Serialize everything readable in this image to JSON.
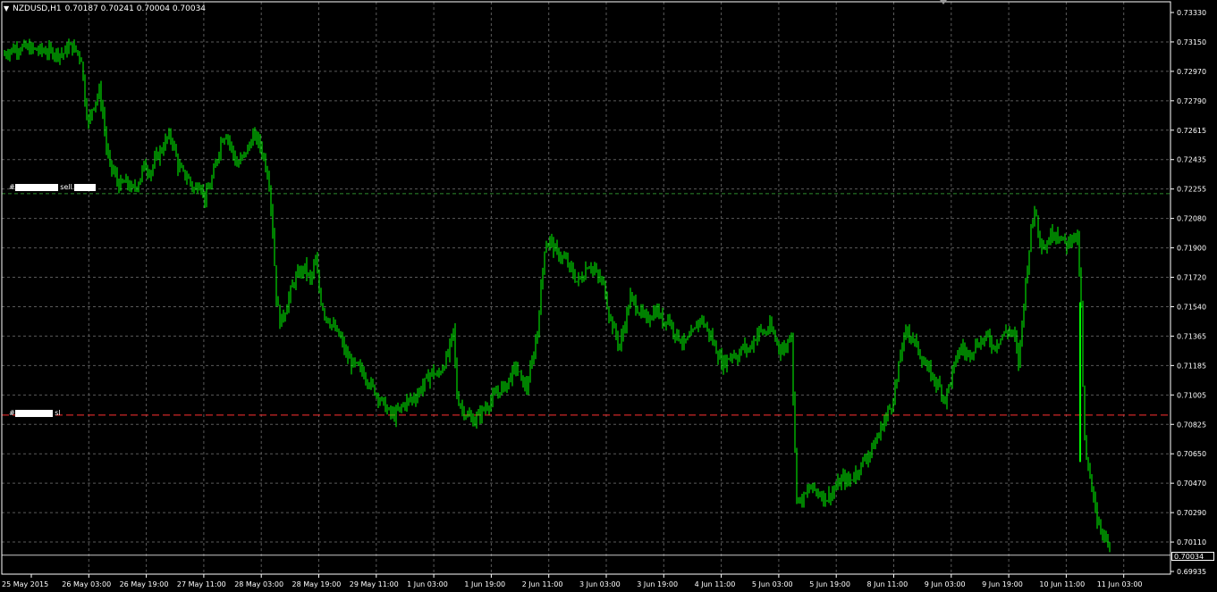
{
  "chart_window": {
    "symbol_header": "NZDUSD,H1",
    "ohlc_header": "0.70187 0.70241 0.70004 0.70034",
    "menu_icon": "triangle-down-icon",
    "colors": {
      "background": "#000000",
      "candle": "#00ff00",
      "grid": "#5a5a5a",
      "axis": "#ffffff",
      "entry_line": "#2e8b2e",
      "sl_line": "#ff3030"
    },
    "orders": {
      "sell_label_prefix": "#",
      "sell_label_mid": "sell",
      "sell_price": 0.7223,
      "sl_label_prefix": "#",
      "sl_label_mid": "sl",
      "sl_price": 0.70885
    },
    "current_price_label": "0.70034"
  },
  "chart_data": {
    "type": "candlestick",
    "symbol": "NZDUSD",
    "timeframe": "H1",
    "y_ticks": [
      "0.73330",
      "0.73150",
      "0.72970",
      "0.72790",
      "0.72615",
      "0.72435",
      "0.72255",
      "0.72080",
      "0.71900",
      "0.71720",
      "0.71540",
      "0.71365",
      "0.71185",
      "0.71005",
      "0.70825",
      "0.70650",
      "0.70470",
      "0.70290",
      "0.70110",
      "0.69935"
    ],
    "ylim": [
      0.69935,
      0.7333
    ],
    "x_ticks": [
      "25 May 2015",
      "26 May 03:00",
      "26 May 19:00",
      "27 May 11:00",
      "28 May 03:00",
      "28 May 19:00",
      "29 May 11:00",
      "1 Jun 03:00",
      "1 Jun 19:00",
      "2 Jun 11:00",
      "3 Jun 03:00",
      "3 Jun 19:00",
      "4 Jun 11:00",
      "5 Jun 03:00",
      "5 Jun 19:00",
      "8 Jun 11:00",
      "9 Jun 03:00",
      "9 Jun 19:00",
      "10 Jun 11:00",
      "11 Jun 03:00"
    ],
    "current_price": 0.70034,
    "grid": true,
    "close_path": [
      [
        0,
        0.7307
      ],
      [
        8,
        0.731
      ],
      [
        20,
        0.7312
      ],
      [
        30,
        0.7311
      ],
      [
        40,
        0.731
      ],
      [
        55,
        0.7309
      ],
      [
        68,
        0.7308
      ],
      [
        75,
        0.7313
      ],
      [
        82,
        0.731
      ],
      [
        88,
        0.7305
      ],
      [
        92,
        0.728
      ],
      [
        96,
        0.7265
      ],
      [
        100,
        0.7275
      ],
      [
        104,
        0.728
      ],
      [
        108,
        0.7285
      ],
      [
        113,
        0.7268
      ],
      [
        116,
        0.725
      ],
      [
        120,
        0.724
      ],
      [
        125,
        0.7235
      ],
      [
        130,
        0.7228
      ],
      [
        138,
        0.723
      ],
      [
        145,
        0.7225
      ],
      [
        152,
        0.723
      ],
      [
        158,
        0.724
      ],
      [
        165,
        0.7236
      ],
      [
        172,
        0.7245
      ],
      [
        178,
        0.725
      ],
      [
        185,
        0.7258
      ],
      [
        190,
        0.7255
      ],
      [
        196,
        0.724
      ],
      [
        202,
        0.7235
      ],
      [
        208,
        0.7232
      ],
      [
        214,
        0.7225
      ],
      [
        220,
        0.723
      ],
      [
        226,
        0.722
      ],
      [
        232,
        0.7228
      ],
      [
        238,
        0.724
      ],
      [
        244,
        0.7255
      ],
      [
        250,
        0.726
      ],
      [
        256,
        0.725
      ],
      [
        262,
        0.724
      ],
      [
        268,
        0.7245
      ],
      [
        274,
        0.725
      ],
      [
        280,
        0.7258
      ],
      [
        286,
        0.7255
      ],
      [
        292,
        0.7245
      ],
      [
        298,
        0.723
      ],
      [
        302,
        0.72
      ],
      [
        306,
        0.716
      ],
      [
        310,
        0.7145
      ],
      [
        315,
        0.715
      ],
      [
        320,
        0.716
      ],
      [
        326,
        0.717
      ],
      [
        332,
        0.7175
      ],
      [
        338,
        0.7178
      ],
      [
        344,
        0.717
      ],
      [
        350,
        0.7182
      ],
      [
        355,
        0.716
      ],
      [
        360,
        0.715
      ],
      [
        366,
        0.7145
      ],
      [
        372,
        0.714
      ],
      [
        378,
        0.7135
      ],
      [
        384,
        0.7125
      ],
      [
        390,
        0.712
      ],
      [
        396,
        0.7118
      ],
      [
        402,
        0.7115
      ],
      [
        408,
        0.711
      ],
      [
        414,
        0.7105
      ],
      [
        420,
        0.71
      ],
      [
        426,
        0.7095
      ],
      [
        432,
        0.709
      ],
      [
        438,
        0.7088
      ],
      [
        444,
        0.7092
      ],
      [
        450,
        0.7096
      ],
      [
        456,
        0.7098
      ],
      [
        462,
        0.71
      ],
      [
        468,
        0.7105
      ],
      [
        474,
        0.711
      ],
      [
        480,
        0.7115
      ],
      [
        486,
        0.7112
      ],
      [
        492,
        0.7118
      ],
      [
        498,
        0.7125
      ],
      [
        504,
        0.714
      ],
      [
        508,
        0.71
      ],
      [
        514,
        0.7092
      ],
      [
        520,
        0.7088
      ],
      [
        526,
        0.7085
      ],
      [
        532,
        0.7088
      ],
      [
        538,
        0.7092
      ],
      [
        544,
        0.7096
      ],
      [
        550,
        0.71
      ],
      [
        556,
        0.7104
      ],
      [
        562,
        0.7106
      ],
      [
        568,
        0.7112
      ],
      [
        574,
        0.7118
      ],
      [
        580,
        0.711
      ],
      [
        586,
        0.7105
      ],
      [
        592,
        0.712
      ],
      [
        598,
        0.714
      ],
      [
        602,
        0.7165
      ],
      [
        606,
        0.719
      ],
      [
        612,
        0.7195
      ],
      [
        618,
        0.7188
      ],
      [
        624,
        0.7185
      ],
      [
        630,
        0.7182
      ],
      [
        636,
        0.7176
      ],
      [
        642,
        0.717
      ],
      [
        648,
        0.7172
      ],
      [
        654,
        0.718
      ],
      [
        660,
        0.7178
      ],
      [
        666,
        0.7172
      ],
      [
        672,
        0.7168
      ],
      [
        678,
        0.715
      ],
      [
        684,
        0.714
      ],
      [
        690,
        0.713
      ],
      [
        696,
        0.7145
      ],
      [
        702,
        0.716
      ],
      [
        708,
        0.7155
      ],
      [
        714,
        0.715
      ],
      [
        720,
        0.7146
      ],
      [
        726,
        0.715
      ],
      [
        732,
        0.7152
      ],
      [
        738,
        0.7145
      ],
      [
        744,
        0.7148
      ],
      [
        750,
        0.714
      ],
      [
        756,
        0.7136
      ],
      [
        762,
        0.7132
      ],
      [
        768,
        0.7135
      ],
      [
        774,
        0.714
      ],
      [
        780,
        0.7148
      ],
      [
        786,
        0.7142
      ],
      [
        792,
        0.7136
      ],
      [
        798,
        0.7128
      ],
      [
        804,
        0.712
      ],
      [
        810,
        0.7122
      ],
      [
        816,
        0.7126
      ],
      [
        822,
        0.7124
      ],
      [
        828,
        0.713
      ],
      [
        834,
        0.7128
      ],
      [
        840,
        0.7134
      ],
      [
        846,
        0.714
      ],
      [
        852,
        0.7138
      ],
      [
        858,
        0.7142
      ],
      [
        864,
        0.7135
      ],
      [
        870,
        0.7128
      ],
      [
        876,
        0.713
      ],
      [
        882,
        0.714
      ],
      [
        885,
        0.708
      ],
      [
        888,
        0.704
      ],
      [
        892,
        0.7036
      ],
      [
        898,
        0.704
      ],
      [
        904,
        0.7045
      ],
      [
        910,
        0.7042
      ],
      [
        916,
        0.704
      ],
      [
        922,
        0.7038
      ],
      [
        928,
        0.7042
      ],
      [
        934,
        0.7046
      ],
      [
        940,
        0.705
      ],
      [
        946,
        0.7048
      ],
      [
        952,
        0.7052
      ],
      [
        958,
        0.7056
      ],
      [
        964,
        0.7062
      ],
      [
        970,
        0.7066
      ],
      [
        976,
        0.7072
      ],
      [
        982,
        0.708
      ],
      [
        988,
        0.7088
      ],
      [
        994,
        0.7095
      ],
      [
        1000,
        0.711
      ],
      [
        1006,
        0.7132
      ],
      [
        1012,
        0.714
      ],
      [
        1018,
        0.7135
      ],
      [
        1024,
        0.7128
      ],
      [
        1030,
        0.712
      ],
      [
        1036,
        0.7115
      ],
      [
        1042,
        0.711
      ],
      [
        1048,
        0.7105
      ],
      [
        1054,
        0.7098
      ],
      [
        1060,
        0.711
      ],
      [
        1066,
        0.7122
      ],
      [
        1072,
        0.713
      ],
      [
        1078,
        0.7125
      ],
      [
        1084,
        0.7128
      ],
      [
        1090,
        0.7132
      ],
      [
        1096,
        0.7134
      ],
      [
        1102,
        0.7136
      ],
      [
        1108,
        0.713
      ],
      [
        1114,
        0.7134
      ],
      [
        1120,
        0.7138
      ],
      [
        1126,
        0.714
      ],
      [
        1132,
        0.7135
      ],
      [
        1136,
        0.712
      ],
      [
        1140,
        0.7145
      ],
      [
        1146,
        0.718
      ],
      [
        1150,
        0.72
      ],
      [
        1154,
        0.7215
      ],
      [
        1160,
        0.7195
      ],
      [
        1166,
        0.719
      ],
      [
        1172,
        0.7198
      ],
      [
        1178,
        0.72
      ],
      [
        1184,
        0.7195
      ],
      [
        1190,
        0.7192
      ],
      [
        1196,
        0.7198
      ],
      [
        1202,
        0.7195
      ],
      [
        1206,
        0.7155
      ],
      [
        1209,
        0.708
      ],
      [
        1212,
        0.706
      ],
      [
        1216,
        0.705
      ],
      [
        1220,
        0.704
      ],
      [
        1224,
        0.7025
      ],
      [
        1228,
        0.702
      ],
      [
        1232,
        0.7015
      ],
      [
        1236,
        0.701
      ],
      [
        1239,
        0.7003
      ]
    ]
  }
}
